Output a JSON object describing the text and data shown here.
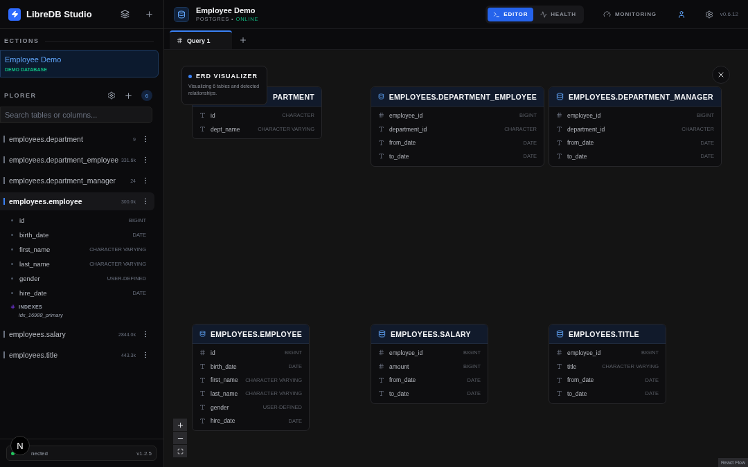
{
  "app": {
    "name": "LibreDB Studio"
  },
  "connections": {
    "heading": "ECTIONS",
    "items": [
      {
        "name": "Employee Demo",
        "tag": "DEMO DATABASE",
        "selected": true
      }
    ]
  },
  "explorer": {
    "heading": "PLORER",
    "count": "6",
    "search": {
      "placeholder": "Search tables or columns..."
    },
    "tables": [
      {
        "name": "employees.department",
        "rows": "9",
        "selected": false
      },
      {
        "name": "employees.department_employee",
        "rows": "331.6k",
        "selected": false
      },
      {
        "name": "employees.department_manager",
        "rows": "24",
        "selected": false
      },
      {
        "name": "employees.employee",
        "rows": "300.0k",
        "selected": true,
        "columns": [
          {
            "name": "id",
            "type": "BIGINT"
          },
          {
            "name": "birth_date",
            "type": "DATE"
          },
          {
            "name": "first_name",
            "type": "CHARACTER VARYING"
          },
          {
            "name": "last_name",
            "type": "CHARACTER VARYING"
          },
          {
            "name": "gender",
            "type": "USER-DEFINED"
          },
          {
            "name": "hire_date",
            "type": "DATE"
          }
        ],
        "indexes_heading": "INDEXES",
        "indexes": [
          "idx_16988_primary"
        ]
      },
      {
        "name": "employees.salary",
        "rows": "2844.0k",
        "selected": false
      },
      {
        "name": "employees.title",
        "rows": "443.3k",
        "selected": false
      }
    ]
  },
  "status": {
    "text": "nected",
    "version": "v1.2.5",
    "badge": "N"
  },
  "header": {
    "title": "Employee Demo",
    "engine": "POSTGRES",
    "separator": "•",
    "state": "ONLINE",
    "modes": [
      {
        "label": "EDITOR",
        "selected": true
      },
      {
        "label": "HEALTH",
        "selected": false
      }
    ],
    "monitoring": "MONITORING",
    "version": "v0.6.12"
  },
  "tabs": [
    {
      "label": "Query 1",
      "selected": true
    }
  ],
  "erd": {
    "popup": {
      "title": "ERD VISUALIZER",
      "text": "Visualizing 6 tables and detected relationships."
    },
    "attribution": "React Flow",
    "nodes": [
      {
        "title": "PARTMENT",
        "columns": [
          {
            "kind": "text",
            "name": "id",
            "type": "CHARACTER"
          },
          {
            "kind": "text",
            "name": "dept_name",
            "type": "CHARACTER VARYING"
          }
        ]
      },
      {
        "title": "EMPLOYEES.DEPARTMENT_EMPLOYEE",
        "columns": [
          {
            "kind": "number",
            "name": "employee_id",
            "type": "BIGINT"
          },
          {
            "kind": "text",
            "name": "department_id",
            "type": "CHARACTER"
          },
          {
            "kind": "text",
            "name": "from_date",
            "type": "DATE"
          },
          {
            "kind": "text",
            "name": "to_date",
            "type": "DATE"
          }
        ]
      },
      {
        "title": "EMPLOYEES.DEPARTMENT_MANAGER",
        "columns": [
          {
            "kind": "number",
            "name": "employee_id",
            "type": "BIGINT"
          },
          {
            "kind": "text",
            "name": "department_id",
            "type": "CHARACTER"
          },
          {
            "kind": "text",
            "name": "from_date",
            "type": "DATE"
          },
          {
            "kind": "text",
            "name": "to_date",
            "type": "DATE"
          }
        ]
      },
      {
        "title": "EMPLOYEES.EMPLOYEE",
        "columns": [
          {
            "kind": "number",
            "name": "id",
            "type": "BIGINT"
          },
          {
            "kind": "text",
            "name": "birth_date",
            "type": "DATE"
          },
          {
            "kind": "text",
            "name": "first_name",
            "type": "CHARACTER VARYING"
          },
          {
            "kind": "text",
            "name": "last_name",
            "type": "CHARACTER VARYING"
          },
          {
            "kind": "text",
            "name": "gender",
            "type": "USER-DEFINED"
          },
          {
            "kind": "text",
            "name": "hire_date",
            "type": "DATE"
          }
        ]
      },
      {
        "title": "EMPLOYEES.SALARY",
        "columns": [
          {
            "kind": "number",
            "name": "employee_id",
            "type": "BIGINT"
          },
          {
            "kind": "number",
            "name": "amount",
            "type": "BIGINT"
          },
          {
            "kind": "text",
            "name": "from_date",
            "type": "DATE"
          },
          {
            "kind": "text",
            "name": "to_date",
            "type": "DATE"
          }
        ]
      },
      {
        "title": "EMPLOYEES.TITLE",
        "columns": [
          {
            "kind": "number",
            "name": "employee_id",
            "type": "BIGINT"
          },
          {
            "kind": "text",
            "name": "title",
            "type": "CHARACTER VARYING"
          },
          {
            "kind": "text",
            "name": "from_date",
            "type": "DATE"
          },
          {
            "kind": "text",
            "name": "to_date",
            "type": "DATE"
          }
        ]
      }
    ]
  }
}
